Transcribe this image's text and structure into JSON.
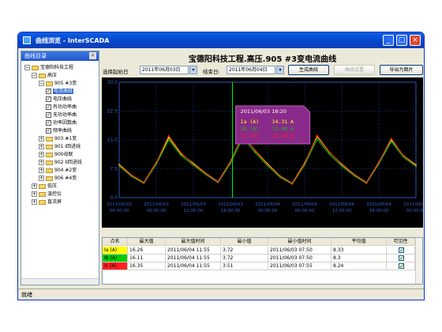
{
  "window": {
    "title": "曲线浏览 - InterSCADA"
  },
  "sidebar": {
    "header": "曲线目录",
    "items": [
      {
        "label": "宝德阳科技工程",
        "level": 1,
        "kind": "folder",
        "exp": "-"
      },
      {
        "label": "高压",
        "level": 2,
        "kind": "folder",
        "exp": "-"
      },
      {
        "label": "905 #3变",
        "level": 3,
        "kind": "folder",
        "exp": "-"
      },
      {
        "label": "电流曲线",
        "level": 4,
        "kind": "check",
        "selected": true
      },
      {
        "label": "电压曲线",
        "level": 4,
        "kind": "check"
      },
      {
        "label": "有功功率曲",
        "level": 4,
        "kind": "check"
      },
      {
        "label": "无功功率曲",
        "level": 4,
        "kind": "check"
      },
      {
        "label": "功率因数曲",
        "level": 4,
        "kind": "check"
      },
      {
        "label": "频率曲线",
        "level": 4,
        "kind": "check"
      },
      {
        "label": "903 #1变",
        "level": 3,
        "kind": "folder",
        "exp": "+"
      },
      {
        "label": "901 I回进线",
        "level": 3,
        "kind": "folder",
        "exp": "+"
      },
      {
        "label": "900母联",
        "level": 3,
        "kind": "folder",
        "exp": "+"
      },
      {
        "label": "902 II回进线",
        "level": 3,
        "kind": "folder",
        "exp": "+"
      },
      {
        "label": "904 #2变",
        "level": 3,
        "kind": "folder",
        "exp": "+"
      },
      {
        "label": "906 #4变",
        "level": 3,
        "kind": "folder",
        "exp": "+"
      },
      {
        "label": "低压",
        "level": 2,
        "kind": "folder",
        "exp": "+"
      },
      {
        "label": "温控仪",
        "level": 2,
        "kind": "folder",
        "exp": "+"
      },
      {
        "label": "直流屏",
        "level": 2,
        "kind": "folder",
        "exp": "+"
      }
    ]
  },
  "main": {
    "title": "宝德阳科技工程.高压.905 #3变电流曲线"
  },
  "toolbar": {
    "start_label": "选择起始日",
    "start_date": "2011年06月03日",
    "end_label": "结束日:",
    "end_date": "2011年06月04日",
    "generate_button": "生成曲线",
    "settings_button": "曲线设置",
    "export_button": "导出为图片"
  },
  "tooltip": {
    "timestamp": "2011/06/03 18:20",
    "rows": [
      {
        "label": "Ia (A)",
        "value": "14.31 A"
      },
      {
        "label": "Ib (A)",
        "value": "12.90 A"
      },
      {
        "label": "Ic (A)",
        "value": "12.09 A"
      }
    ]
  },
  "chart_data": {
    "type": "line",
    "y_ticks": [
      "30.0",
      "22.5",
      "15.0",
      "7.5",
      "0.0"
    ],
    "ylim": [
      0,
      30
    ],
    "x_ticks": [
      {
        "date": "2011/06/03",
        "time": "00:00:00"
      },
      {
        "date": "2011/06/03",
        "time": "06:00:00"
      },
      {
        "date": "2011/06/03",
        "time": "12:00:00"
      },
      {
        "date": "2011/06/03",
        "time": "18:00:00"
      },
      {
        "date": "2011/06/04",
        "time": "00:00:00"
      },
      {
        "date": "2011/06/04",
        "time": "06:00:00"
      },
      {
        "date": "2011/06/04",
        "time": "12:00:00"
      },
      {
        "date": "2011/06/04",
        "time": "18:00:00"
      },
      {
        "date": "2011/06/05",
        "time": "00:00:00"
      }
    ],
    "cursor_time": "2011/06/03 18:20",
    "x_hours": [
      0,
      2,
      4,
      6,
      8,
      10,
      12,
      14,
      16,
      18,
      20,
      22,
      24,
      26,
      28,
      30,
      32,
      34,
      36,
      38,
      40,
      42,
      44,
      46,
      48
    ],
    "series": [
      {
        "name": "Ia (A)",
        "color": "#ffff00",
        "values": [
          8.6,
          5.8,
          3.9,
          9.1,
          15.6,
          11.4,
          8.9,
          6.3,
          4.1,
          9.4,
          16.3,
          12.2,
          8.8,
          5.6,
          3.7,
          9.0,
          15.9,
          11.8,
          8.7,
          6.0,
          3.9,
          9.2,
          15.1,
          10.9,
          8.5
        ]
      },
      {
        "name": "Ib (A)",
        "color": "#00cc00",
        "values": [
          8.2,
          5.5,
          3.7,
          8.7,
          15.0,
          11.0,
          8.4,
          6.0,
          3.9,
          8.9,
          15.6,
          11.7,
          8.3,
          5.3,
          3.5,
          8.5,
          15.2,
          11.3,
          8.2,
          5.7,
          3.7,
          8.8,
          14.6,
          10.5,
          8.1
        ]
      },
      {
        "name": "Ic (A)",
        "color": "#ff2020",
        "values": [
          8.4,
          5.7,
          3.8,
          9.0,
          16.1,
          11.6,
          8.7,
          6.2,
          4.0,
          9.3,
          16.4,
          12.1,
          8.6,
          5.5,
          3.6,
          8.8,
          16.2,
          11.9,
          8.5,
          5.9,
          3.8,
          9.1,
          15.4,
          10.8,
          8.3
        ]
      }
    ]
  },
  "table": {
    "headers": [
      "点名",
      "最大值",
      "最大值时间",
      "最小值",
      "最小值时间",
      "平均值",
      "可见性"
    ],
    "rows": [
      {
        "name": "Ia (A)",
        "color": "#ffff00",
        "max": "16.26",
        "max_time": "2011/06/04 11:55",
        "min": "3.72",
        "min_time": "2011/06/03 07:50",
        "avg": "8.33",
        "visible": "✔"
      },
      {
        "name": "Ib (A)",
        "color": "#00cc00",
        "max": "16.11",
        "max_time": "2011/06/04 11:55",
        "min": "3.72",
        "min_time": "2011/06/03 07:50",
        "avg": "8.3",
        "visible": "✔"
      },
      {
        "name": "Ic (A)",
        "color": "#ff2020",
        "max": "16.35",
        "max_time": "2011/06/04 11:55",
        "min": "3.51",
        "min_time": "2011/06/03 07:55",
        "avg": "8.24",
        "visible": "✔"
      }
    ]
  },
  "status": {
    "text": "就绪"
  }
}
